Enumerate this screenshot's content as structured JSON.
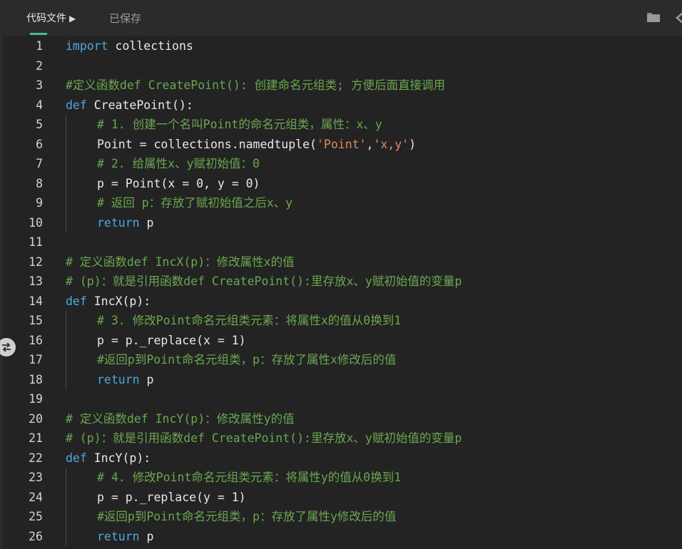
{
  "tabbar": {
    "active_tab": "代码文件",
    "saved_status": "已保存"
  },
  "colors": {
    "background": "#2b2b2b",
    "editor_bg": "#232323",
    "keyword": "#4fa8e0",
    "string": "#e08a5a",
    "comment": "#6aa84f",
    "text": "#e8e8e8",
    "tab_accent": "#3fbf8f"
  },
  "icons": {
    "tab_arrow": "play-triangle-icon",
    "folder": "folder-icon",
    "collapse": "collapse-arrow-icon",
    "panel_toggle": "swap-arrows-icon"
  },
  "lines": [
    {
      "n": "1",
      "indent": 0,
      "tokens": [
        [
          "kw",
          "import"
        ],
        [
          "fn",
          " collections"
        ]
      ]
    },
    {
      "n": "2",
      "indent": 0,
      "tokens": []
    },
    {
      "n": "3",
      "indent": 0,
      "tokens": [
        [
          "cmt",
          "#定义函数def CreatePoint(): 创建命名元组类; 方便后面直接调用"
        ]
      ]
    },
    {
      "n": "4",
      "indent": 0,
      "tokens": [
        [
          "kw",
          "def"
        ],
        [
          "fn",
          " CreatePoint():"
        ]
      ]
    },
    {
      "n": "5",
      "indent": 1,
      "tokens": [
        [
          "cmt",
          "# 1. 创建一个名叫Point的命名元组类，属性：x、y"
        ]
      ]
    },
    {
      "n": "6",
      "indent": 1,
      "tokens": [
        [
          "fn",
          "Point = collections.namedtuple("
        ],
        [
          "str",
          "'Point'"
        ],
        [
          "fn",
          ","
        ],
        [
          "str",
          "'x,y'"
        ],
        [
          "fn",
          ")"
        ]
      ]
    },
    {
      "n": "7",
      "indent": 1,
      "tokens": [
        [
          "cmt",
          "# 2. 给属性x、y赋初始值：0"
        ]
      ]
    },
    {
      "n": "8",
      "indent": 1,
      "tokens": [
        [
          "fn",
          "p = Point(x = 0, y = 0)"
        ]
      ]
    },
    {
      "n": "9",
      "indent": 1,
      "tokens": [
        [
          "cmt",
          "# 返回 p：存放了赋初始值之后x、y"
        ]
      ]
    },
    {
      "n": "10",
      "indent": 1,
      "tokens": [
        [
          "kw",
          "return"
        ],
        [
          "fn",
          " p"
        ]
      ]
    },
    {
      "n": "11",
      "indent": 0,
      "tokens": []
    },
    {
      "n": "12",
      "indent": 0,
      "tokens": [
        [
          "cmt",
          "# 定义函数def IncX(p)：修改属性x的值"
        ]
      ]
    },
    {
      "n": "13",
      "indent": 0,
      "tokens": [
        [
          "cmt",
          "# (p)：就是引用函数def CreatePoint():里存放x、y赋初始值的变量p"
        ]
      ]
    },
    {
      "n": "14",
      "indent": 0,
      "tokens": [
        [
          "kw",
          "def"
        ],
        [
          "fn",
          " IncX(p):"
        ]
      ]
    },
    {
      "n": "15",
      "indent": 1,
      "tokens": [
        [
          "cmt",
          "# 3. 修改Point命名元组类元素：将属性x的值从0换到1"
        ]
      ]
    },
    {
      "n": "16",
      "indent": 1,
      "tokens": [
        [
          "fn",
          "p = p._replace(x = 1)"
        ]
      ]
    },
    {
      "n": "17",
      "indent": 1,
      "tokens": [
        [
          "cmt",
          "#返回p到Point命名元组类，p：存放了属性x修改后的值"
        ]
      ]
    },
    {
      "n": "18",
      "indent": 1,
      "tokens": [
        [
          "kw",
          "return"
        ],
        [
          "fn",
          " p"
        ]
      ]
    },
    {
      "n": "19",
      "indent": 0,
      "tokens": []
    },
    {
      "n": "20",
      "indent": 0,
      "tokens": [
        [
          "cmt",
          "# 定义函数def IncY(p)：修改属性y的值"
        ]
      ]
    },
    {
      "n": "21",
      "indent": 0,
      "tokens": [
        [
          "cmt",
          "# (p)：就是引用函数def CreatePoint():里存放x、y赋初始值的变量p"
        ]
      ]
    },
    {
      "n": "22",
      "indent": 0,
      "tokens": [
        [
          "kw",
          "def"
        ],
        [
          "fn",
          " IncY(p):"
        ]
      ]
    },
    {
      "n": "23",
      "indent": 1,
      "tokens": [
        [
          "cmt",
          "# 4. 修改Point命名元组类元素：将属性y的值从0换到1"
        ]
      ]
    },
    {
      "n": "24",
      "indent": 1,
      "tokens": [
        [
          "fn",
          "p = p._replace(y = 1)"
        ]
      ]
    },
    {
      "n": "25",
      "indent": 1,
      "tokens": [
        [
          "cmt",
          "#返回p到Point命名元组类，p：存放了属性y修改后的值"
        ]
      ]
    },
    {
      "n": "26",
      "indent": 1,
      "tokens": [
        [
          "kw",
          "return"
        ],
        [
          "fn",
          " p"
        ]
      ]
    }
  ]
}
